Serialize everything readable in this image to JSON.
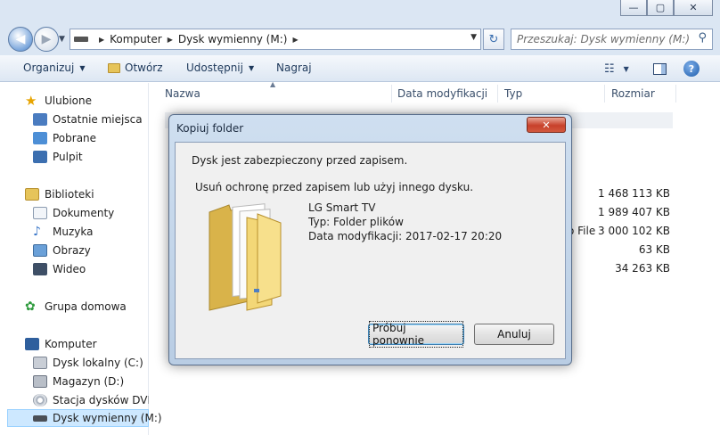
{
  "window": {
    "minimize_glyph": "—",
    "maximize_glyph": "▢",
    "close_glyph": "✕"
  },
  "address": {
    "back_glyph": "◀",
    "forward_glyph": "▶",
    "crumbs": [
      "Komputer",
      "Dysk wymienny (M:)"
    ],
    "refresh_glyph": "↻",
    "search_placeholder": "Przeszukaj: Dysk wymienny (M:)"
  },
  "toolbar": {
    "organize": "Organizuj",
    "open": "Otwórz",
    "share": "Udostępnij",
    "burn": "Nagraj",
    "help_glyph": "?"
  },
  "navpane": {
    "favorites": "Ulubione",
    "recent": "Ostatnie miejsca",
    "downloads": "Pobrane",
    "desktop": "Pulpit",
    "libraries": "Biblioteki",
    "documents": "Dokumenty",
    "music": "Muzyka",
    "pictures": "Obrazy",
    "videos": "Wideo",
    "homegroup": "Grupa domowa",
    "computer": "Komputer",
    "local_disk": "Dysk lokalny (C:)",
    "storage": "Magazyn (D:)",
    "dvd": "Stacja dysków DVD R",
    "removable": "Dysk wymienny (M:)"
  },
  "filelist": {
    "columns": [
      "Nazwa",
      "Data modyfikacji",
      "Typ",
      "Rozmiar"
    ],
    "sizes": [
      "1 468 113 KB",
      "1 989 407 KB",
      "3 000 102 KB",
      "63 KB",
      "34 263 KB"
    ],
    "partial_type": "o File"
  },
  "dialog": {
    "title": "Kopiuj folder",
    "close_glyph": "✕",
    "message1": "Dysk jest zabezpieczony przed zapisem.",
    "message2": "Usuń ochronę przed zapisem lub użyj innego dysku.",
    "item_name": "LG Smart TV",
    "item_type": "Typ: Folder plików",
    "item_date": "Data modyfikacji: 2017-02-17 20:20",
    "retry_button": "Próbuj ponownie",
    "cancel_button": "Anuluj"
  }
}
